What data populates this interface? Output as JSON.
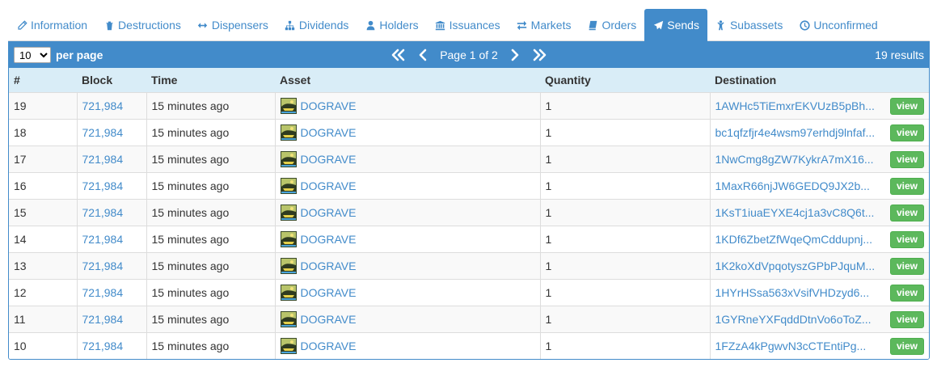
{
  "tabs": [
    {
      "label": "Information",
      "icon": "pencil-icon"
    },
    {
      "label": "Destructions",
      "icon": "trash-icon"
    },
    {
      "label": "Dispensers",
      "icon": "arrows-horizontal-icon"
    },
    {
      "label": "Dividends",
      "icon": "sitemap-icon"
    },
    {
      "label": "Holders",
      "icon": "user-icon"
    },
    {
      "label": "Issuances",
      "icon": "bank-icon"
    },
    {
      "label": "Markets",
      "icon": "exchange-icon"
    },
    {
      "label": "Orders",
      "icon": "book-icon"
    },
    {
      "label": "Sends",
      "icon": "paper-plane-icon",
      "active": true
    },
    {
      "label": "Subassets",
      "icon": "child-icon"
    },
    {
      "label": "Unconfirmed",
      "icon": "clock-icon"
    }
  ],
  "toolbar": {
    "per_page_value": "10",
    "per_page_label": "per page",
    "page_text": "Page 1 of 2",
    "results_count": "19",
    "results_label": "results"
  },
  "table": {
    "headers": [
      "#",
      "Block",
      "Time",
      "Asset",
      "Quantity",
      "Destination"
    ],
    "view_label": "view",
    "rows": [
      {
        "num": "19",
        "block": "721,984",
        "time": "15 minutes ago",
        "asset": "DOGRAVE",
        "quantity": "1",
        "destination": "1AWHc5TiEmxrEKVUzB5pBh..."
      },
      {
        "num": "18",
        "block": "721,984",
        "time": "15 minutes ago",
        "asset": "DOGRAVE",
        "quantity": "1",
        "destination": "bc1qfzfjr4e4wsm97erhdj9lnfaf..."
      },
      {
        "num": "17",
        "block": "721,984",
        "time": "15 minutes ago",
        "asset": "DOGRAVE",
        "quantity": "1",
        "destination": "1NwCmg8gZW7KykrA7mX16..."
      },
      {
        "num": "16",
        "block": "721,984",
        "time": "15 minutes ago",
        "asset": "DOGRAVE",
        "quantity": "1",
        "destination": "1MaxR66njJW6GEDQ9JX2b..."
      },
      {
        "num": "15",
        "block": "721,984",
        "time": "15 minutes ago",
        "asset": "DOGRAVE",
        "quantity": "1",
        "destination": "1KsT1iuaEYXE4cj1a3vC8Q6t..."
      },
      {
        "num": "14",
        "block": "721,984",
        "time": "15 minutes ago",
        "asset": "DOGRAVE",
        "quantity": "1",
        "destination": "1KDf6ZbetZfWqeQmCddupnj..."
      },
      {
        "num": "13",
        "block": "721,984",
        "time": "15 minutes ago",
        "asset": "DOGRAVE",
        "quantity": "1",
        "destination": "1K2koXdVpqotyszGPbPJquM..."
      },
      {
        "num": "12",
        "block": "721,984",
        "time": "15 minutes ago",
        "asset": "DOGRAVE",
        "quantity": "1",
        "destination": "1HYrHSsa563xVsifVHDzyd6..."
      },
      {
        "num": "11",
        "block": "721,984",
        "time": "15 minutes ago",
        "asset": "DOGRAVE",
        "quantity": "1",
        "destination": "1GYRneYXFqddDtnVo6oToZ..."
      },
      {
        "num": "10",
        "block": "721,984",
        "time": "15 minutes ago",
        "asset": "DOGRAVE",
        "quantity": "1",
        "destination": "1FZzA4kPgwvN3cCTEntiPg..."
      }
    ]
  },
  "colors": {
    "accent": "#428bca",
    "header_row": "#d9edf7",
    "view_button": "#5cb85c"
  }
}
